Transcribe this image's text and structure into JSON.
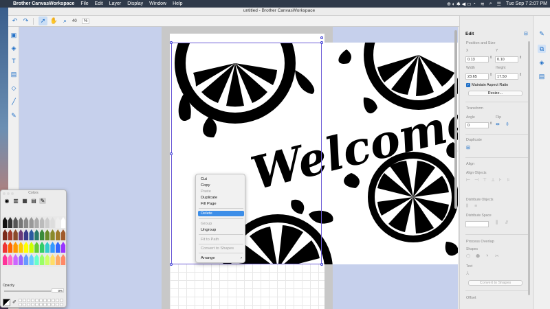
{
  "menubar": {
    "apple": "",
    "items": [
      "Brother CanvasWorkspace",
      "File",
      "Edit",
      "Layer",
      "Display",
      "Window",
      "Help"
    ],
    "clock": "Tue Sep 7  2:07 PM"
  },
  "window": {
    "title": "untitled - Brother CanvasWorkspace"
  },
  "toolbar": {
    "zoom_value": "40",
    "zoom_unit": "%"
  },
  "design": {
    "text": "Welcome"
  },
  "context_menu": {
    "items": [
      {
        "label": "Cut",
        "enabled": true
      },
      {
        "label": "Copy",
        "enabled": true
      },
      {
        "label": "Paste",
        "enabled": false
      },
      {
        "label": "Duplicate",
        "enabled": true
      },
      {
        "label": "Fill Page",
        "enabled": true
      },
      {
        "label": "Delete",
        "enabled": true,
        "highlighted": true
      },
      {
        "label": "Group",
        "enabled": false
      },
      {
        "label": "Ungroup",
        "enabled": true
      },
      {
        "label": "Fit to Path",
        "enabled": false
      },
      {
        "label": "Convert to Shapes",
        "enabled": false
      },
      {
        "label": "Arrange",
        "enabled": true,
        "submenu": true
      }
    ]
  },
  "colors_panel": {
    "title": "Colors",
    "opacity_label": "Opacity",
    "opacity_value": "0%"
  },
  "edit_panel": {
    "title": "Edit",
    "position_size": "Position and Size",
    "x_label": "X",
    "x_value": "0.13",
    "y_label": "Y",
    "y_value": "0.10",
    "width_label": "Width",
    "width_value": "23.65",
    "height_label": "Height",
    "height_value": "17.50",
    "maintain_aspect": "Maintain Aspect Ratio",
    "resize_button": "Resize...",
    "transform": "Transform",
    "angle_label": "Angle",
    "angle_value": "0",
    "flip_label": "Flip",
    "duplicate": "Duplicate",
    "align": "Align",
    "align_objects": "Align Objects",
    "distribute_objects": "Distribute Objects",
    "distribute_space": "Distribute Space",
    "process_overlap": "Process Overlap",
    "shapes": "Shapes",
    "text": "Text",
    "convert_button": "Convert to Shapes",
    "offset": "Offset"
  }
}
